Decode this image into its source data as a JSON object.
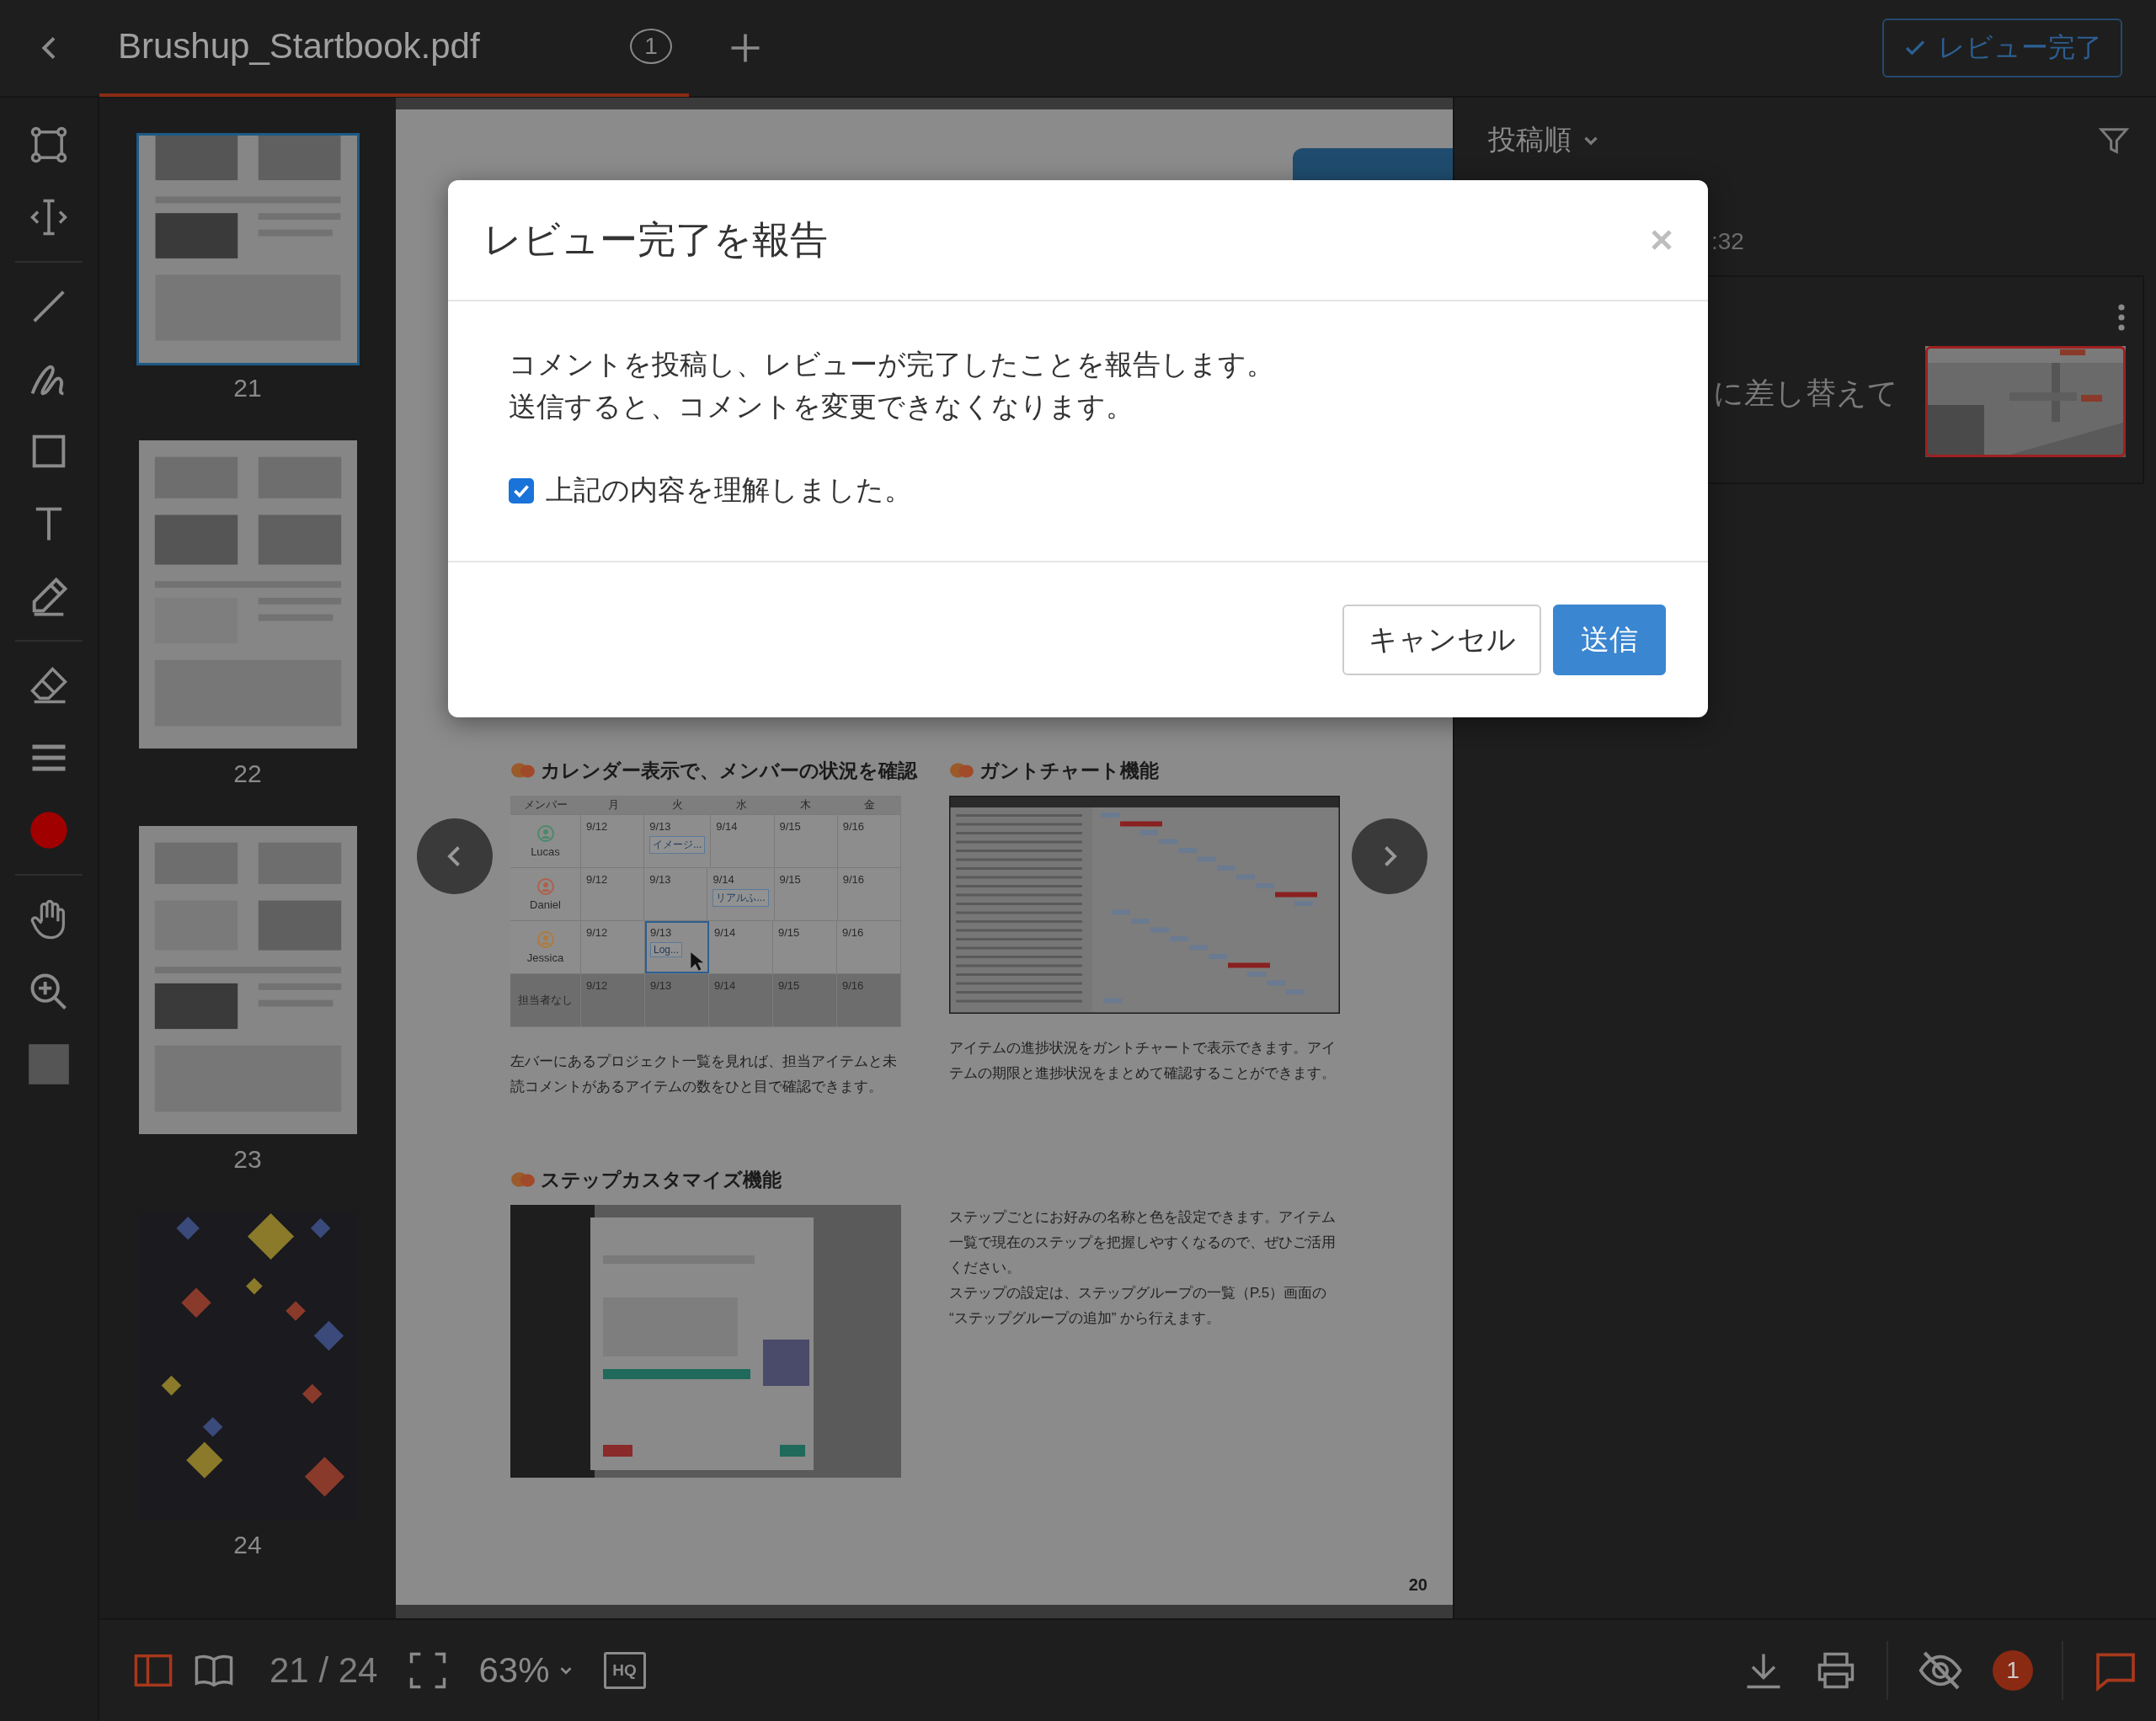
{
  "top_bar": {
    "file_tab": {
      "label": "Brushup_Startbook.pdf",
      "selected": true
    },
    "page_badge": "1",
    "review_button": "レビュー完了"
  },
  "thumbnails": [
    {
      "label": "21",
      "selected": true
    },
    {
      "label": "22",
      "selected": false
    },
    {
      "label": "23",
      "selected": false
    },
    {
      "label": "24",
      "selected": false
    }
  ],
  "page": {
    "sections": [
      {
        "heading": "カレンダー表示で、メンバーの状況を確認",
        "kind": "calendar",
        "caption": [
          "左バーにあるプロジェクト一覧を見れば、担当アイテムと未読コメントがあるアイテムの数をひと目で確認できます。"
        ]
      },
      {
        "heading": "ガントチャート機能",
        "kind": "gantt",
        "caption": [
          "アイテムの進捗状況をガントチャートで表示できます。アイテムの期限と進捗状況をまとめて確認することができます。"
        ]
      },
      {
        "heading": "ステップカスタマイズ機能",
        "kind": "steps",
        "caption": [
          "ステップごとにお好みの名称と色を設定できます。アイテム一覧で現在のステップを把握しやすくなるので、ぜひご活用ください。",
          "ステップの設定は、ステップグループの一覧（P.5）画面の “ステップグループの追加” から行えます。"
        ]
      }
    ],
    "calendar": {
      "columns": [
        "メンバー",
        "月",
        "火",
        "水",
        "木",
        "金"
      ],
      "rows": [
        {
          "member": "Lucas",
          "color": "#4a8a6a",
          "unassigned": false,
          "cells": [
            {
              "date": "9/12",
              "selected": false
            },
            {
              "date": "9/13",
              "event": "イメージ...",
              "selected": false
            },
            {
              "date": "9/14",
              "selected": false
            },
            {
              "date": "9/15",
              "selected": false
            },
            {
              "date": "9/16",
              "selected": false
            }
          ]
        },
        {
          "member": "Daniel",
          "color": "#b0604a",
          "unassigned": false,
          "cells": [
            {
              "date": "9/12",
              "selected": false
            },
            {
              "date": "9/13",
              "selected": false
            },
            {
              "date": "9/14",
              "event": "リアルふ...",
              "selected": false
            },
            {
              "date": "9/15",
              "selected": false
            },
            {
              "date": "9/16",
              "selected": false
            }
          ]
        },
        {
          "member": "Jessica",
          "color": "#b07a3a",
          "unassigned": false,
          "cells": [
            {
              "date": "9/12",
              "selected": false
            },
            {
              "date": "9/13",
              "event": "Log...",
              "selected": true
            },
            {
              "date": "9/14",
              "selected": false
            },
            {
              "date": "9/15",
              "selected": false
            },
            {
              "date": "9/16",
              "selected": false
            }
          ]
        },
        {
          "member": "担当者なし",
          "unassigned": true,
          "cells": [
            {
              "date": "9/12",
              "selected": false
            },
            {
              "date": "9/13",
              "selected": false
            },
            {
              "date": "9/14",
              "selected": false
            },
            {
              "date": "9/15",
              "selected": false
            },
            {
              "date": "9/16",
              "selected": false
            }
          ]
        }
      ]
    },
    "page_number": "20"
  },
  "comments_panel": {
    "sort": "投稿順",
    "comment": {
      "time": ":32",
      "text": "に差し替えて"
    }
  },
  "dialog": {
    "title": "レビュー完了を報告",
    "message": [
      "コメントを投稿し、レビューが完了したことを報告します。",
      "送信すると、コメントを変更できなくなります。"
    ],
    "confirm": {
      "label": "上記の内容を理解しました。",
      "checked": true
    },
    "buttons": [
      {
        "label": "キャンセル",
        "kind": "secondary"
      },
      {
        "label": "送信",
        "kind": "primary"
      }
    ]
  },
  "bottom_bar": {
    "view_modes": [
      {
        "kind": "sidebar",
        "selected": true
      },
      {
        "kind": "book",
        "selected": false
      }
    ],
    "page_indicator": "21 / 24",
    "zoom": "63%",
    "hq": "HQ",
    "annotations_visible": false,
    "notification_count": "1",
    "comments_open": true
  }
}
